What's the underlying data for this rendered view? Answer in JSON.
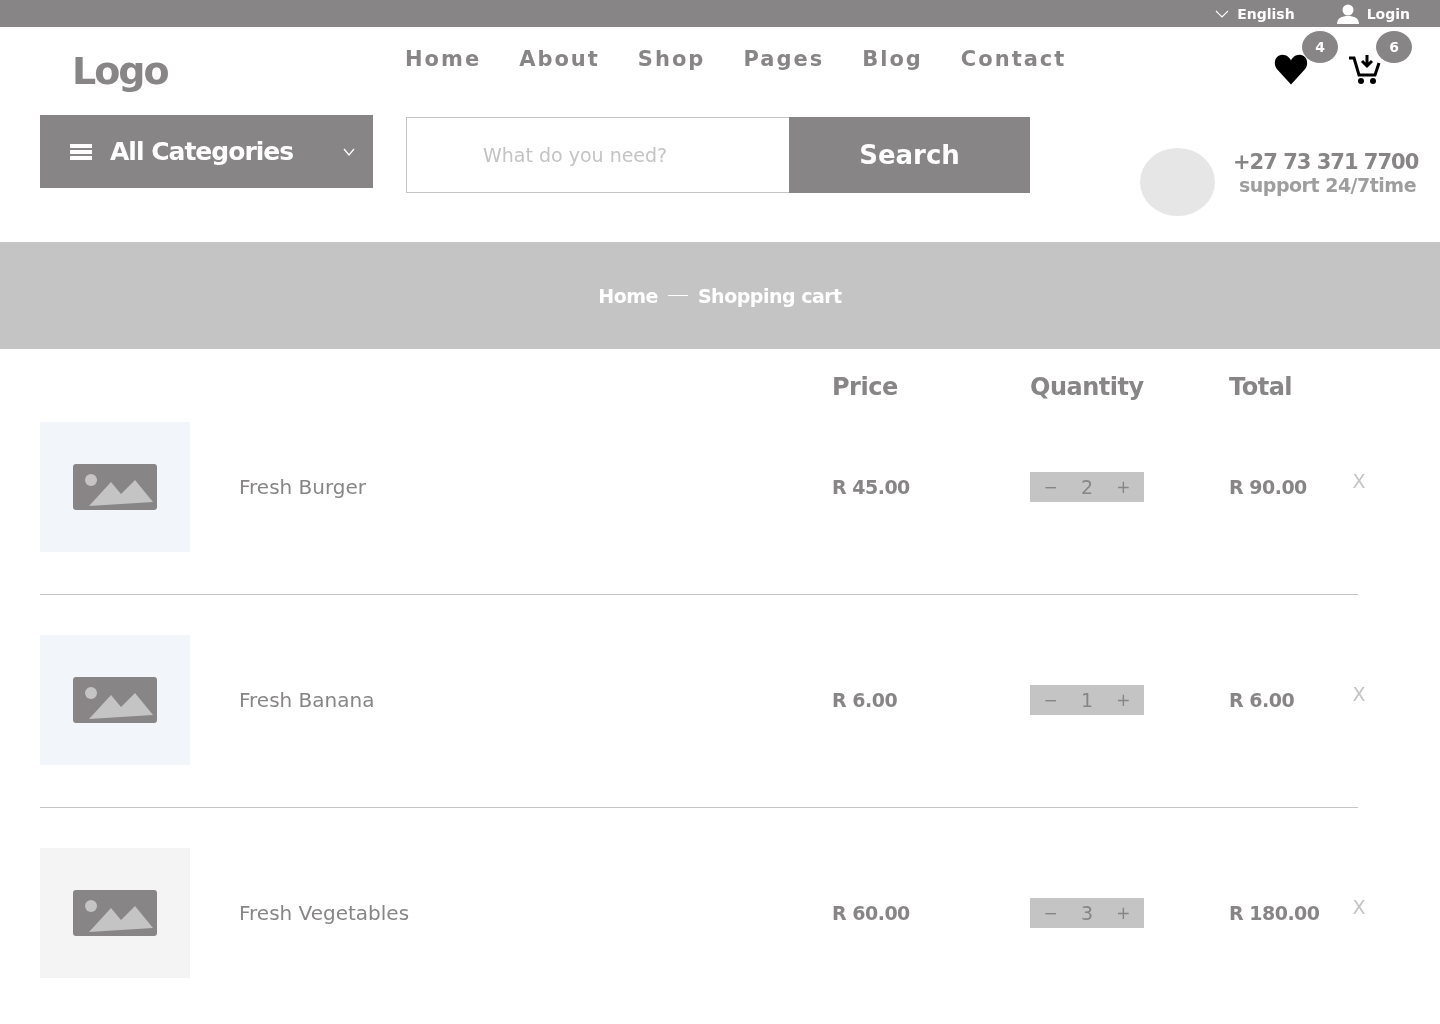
{
  "top_bar": {
    "language": "English",
    "login": "Login"
  },
  "logo": "Logo",
  "nav": [
    "Home",
    "About",
    "Shop",
    "Pages",
    "Blog",
    "Contact"
  ],
  "wishlist": {
    "count": "4"
  },
  "cart": {
    "count": "6"
  },
  "categories": {
    "label": "All Categories"
  },
  "search": {
    "placeholder": "What do you need?",
    "button": "Search"
  },
  "contact": {
    "phone": "+27 73 371 7700",
    "note": "support 24/7time"
  },
  "breadcrumb": [
    "Home",
    "Shopping cart"
  ],
  "table": {
    "columns": [
      "Price",
      "Quantity",
      "Total"
    ],
    "rows": [
      {
        "name": "Fresh Burger",
        "price": "R 45.00",
        "minus": "−",
        "qty": "2",
        "plus": "+",
        "total": "R 90.00",
        "remove": "X"
      },
      {
        "name": "Fresh Banana",
        "price": "R 6.00",
        "minus": "−",
        "qty": "1",
        "plus": "+",
        "total": "R 6.00",
        "remove": "X"
      },
      {
        "name": "Fresh Vegetables",
        "price": "R 60.00",
        "minus": "−",
        "qty": "3",
        "plus": "+",
        "total": "R 180.00",
        "remove": "X"
      }
    ]
  }
}
